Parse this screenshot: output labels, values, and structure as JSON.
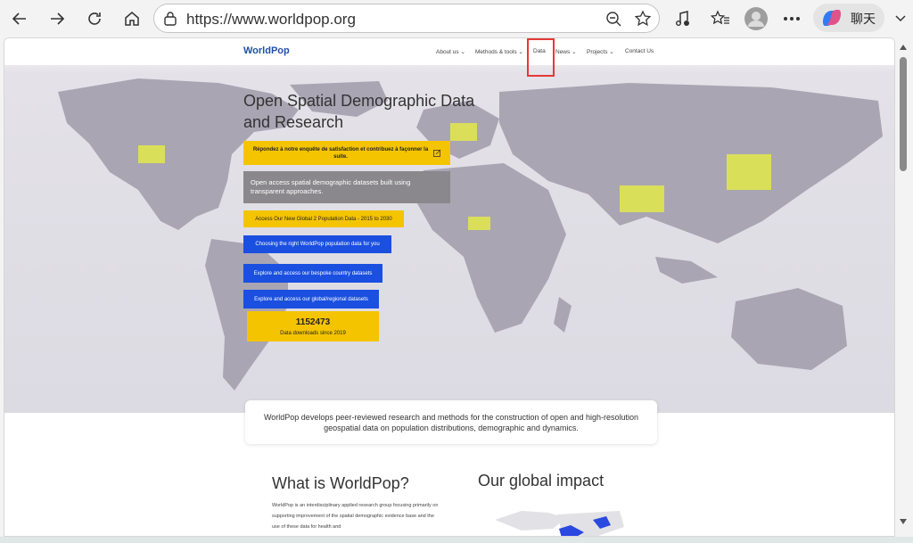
{
  "browser": {
    "url": "https://www.worldpop.org",
    "copilot_label": "聊天"
  },
  "site": {
    "logo": "WorldPop",
    "nav": [
      "About us",
      "Methods & tools",
      "Data",
      "News",
      "Projects",
      "Contact Us"
    ],
    "highlighted_nav_item": "Data"
  },
  "hero": {
    "headline": "Open Spatial Demographic Data and Research",
    "survey_banner": "Répondez à notre enquête de satisfaction et contribuez à façonner la suite.",
    "tagline": "Open access spatial demographic datasets built using transparent approaches.",
    "buttons": [
      "Access Our New Global 2 Population Data - 2015 to 2030",
      "Choosing the right WorldPop population data for you",
      "Explore and access our bespoke country datasets",
      "Explore and access our global/regional datasets"
    ],
    "downloads_count": "1152473",
    "downloads_label": "Data downloads since 2019"
  },
  "intro_text": "WorldPop develops peer-reviewed research and methods for the construction of open and high-resolution geospatial data on population distributions, demographic and dynamics.",
  "sections": {
    "what_is_title": "What is WorldPop?",
    "what_is_text": "WorldPop is an interdisciplinary applied research group focusing primarily on supporting improvement of the spatial demographic evidence base and the use of these data for health and",
    "impact_title": "Our global impact"
  },
  "colors": {
    "accent_yellow": "#f5c400",
    "accent_blue": "#1a4fe0",
    "highlight_red": "#e53935",
    "brand_blue": "#1e4fa8"
  }
}
